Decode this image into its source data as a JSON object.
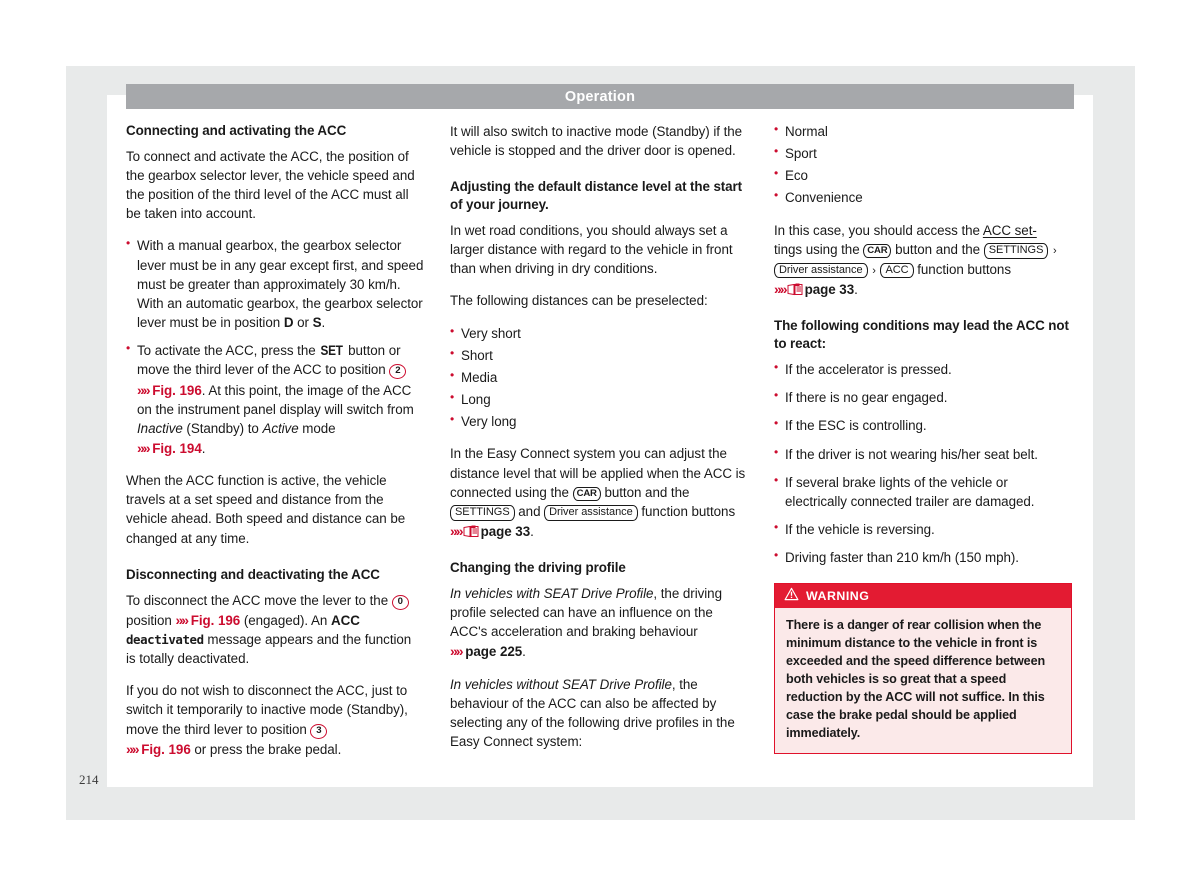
{
  "page": {
    "running_head": "Operation",
    "folio": "214",
    "accent_red": "#cc0c2f",
    "header_grey": "#a6a8ab",
    "frame_grey": "#e8eaea"
  },
  "column1": {
    "heading1": "Connecting and activating the ACC",
    "para1": "To connect and activate the ACC, the position of the gearbox selector lever, the vehicle speed and the position of the third level of the ACC must all be taken into account.",
    "bullet1": {
      "text_a": "With a manual gearbox, the gearbox selector lever must be in any gear except first, and speed must be greater than approximately 30 km/h. With an automatic gearbox, the gearbox selector lever must be in position ",
      "gear_d": "D",
      "or": " or ",
      "gear_s": "S",
      "text_b": "."
    },
    "bullet2": {
      "text_a": "To activate the ACC, press the ",
      "key_set": "SET",
      "text_b": " button or move the third lever of the ACC to position ",
      "circle_2": "2",
      "arrows": "»»",
      "ref_fig196": "Fig. 196",
      "text_c": ". At this point, the image of the ACC on the instrument panel display will switch from ",
      "italic_inactive": "Inactive",
      "text_d": " (Standby) to ",
      "italic_active": "Active",
      "text_e": " mode ",
      "ref_fig194": "Fig. 194",
      "text_f": "."
    },
    "para2": "When the ACC function is active, the vehicle travels at a set speed and distance from the vehicle ahead. Both speed and distance can be changed at any time.",
    "heading2": "Disconnecting and deactivating the ACC",
    "para3": {
      "text_a": "To disconnect the ACC move the lever to the ",
      "circle_0": "0",
      "text_b": " position ",
      "ref_fig196": "Fig. 196",
      "text_c": " (engaged). An ",
      "bold_acc": "ACC",
      "msg_deactivated": "deactivated",
      "text_d": " message appears and the function is totally deactivated."
    },
    "para4": {
      "text_a": "If you do not wish to disconnect the ACC, just to switch it temporarily to inactive mode (Standby), move the third lever to position ",
      "circle_3": "3",
      "ref_fig196": "Fig. 196",
      "text_b": " or press the brake pedal."
    }
  },
  "column2": {
    "para1": "It will also switch to inactive mode (Standby) if the vehicle is stopped and the driver door is opened.",
    "heading1": "Adjusting the default distance level at the start of your journey.",
    "para2": "In wet road conditions, you should always set a larger distance with regard to the vehicle in front than when driving in dry conditions.",
    "para3": "The following distances can be preselected:",
    "distances": [
      "Very short",
      "Short",
      "Media",
      "Long",
      "Very long"
    ],
    "para4": {
      "text_a": "In the Easy Connect system you can adjust the distance level that will be applied when the ACC is connected using the ",
      "btn_car": "CAR",
      "text_b": " button and the ",
      "btn_settings": "SETTINGS",
      "text_c": " and ",
      "btn_driver_assistance": "Driver assistance",
      "text_d": " function buttons ",
      "page_ref": "page 33",
      "text_e": "."
    },
    "heading2": "Changing the driving profile",
    "para5": {
      "italic_a": "In vehicles with SEAT Drive Profile",
      "text_a": ", the driving profile selected can have an influence on the ACC's acceleration and braking behaviour ",
      "page_ref": "page 225",
      "text_b": "."
    },
    "para6": {
      "italic_a": "In vehicles without SEAT Drive Profile",
      "text_a": ", the behaviour of the ACC can also be affected by selecting any of the following drive profiles in the Easy Connect system:"
    }
  },
  "column3": {
    "profiles": [
      "Normal",
      "Sport",
      "Eco",
      "Convenience"
    ],
    "para1": {
      "text_a": "In this case, you should access the ",
      "underlined": "ACC set-",
      "text_b": "tings using the ",
      "btn_car": "CAR",
      "text_c": " button and the ",
      "btn_settings": "SETTINGS",
      "sep1": "›",
      "btn_driver_assistance": "Driver assistance",
      "sep2": "›",
      "btn_acc": "ACC",
      "text_d": " function buttons ",
      "page_ref": "page 33",
      "text_e": "."
    },
    "heading1": "The following conditions may lead the ACC not to react:",
    "conditions": [
      "If the accelerator is pressed.",
      "If there is no gear engaged.",
      "If the ESC is controlling.",
      "If the driver is not wearing his/her seat belt.",
      "If several brake lights of the vehicle or electrically connected trailer are damaged.",
      "If the vehicle is reversing.",
      "Driving faster than 210 km/h (150 mph)."
    ],
    "warning": {
      "title": "WARNING",
      "body": "There is a danger of rear collision when the minimum distance to the vehicle in front is exceeded and the speed difference between both vehicles is so great that a speed reduction by the ACC will not suffice. In this case the brake pedal should be applied immediately."
    }
  }
}
